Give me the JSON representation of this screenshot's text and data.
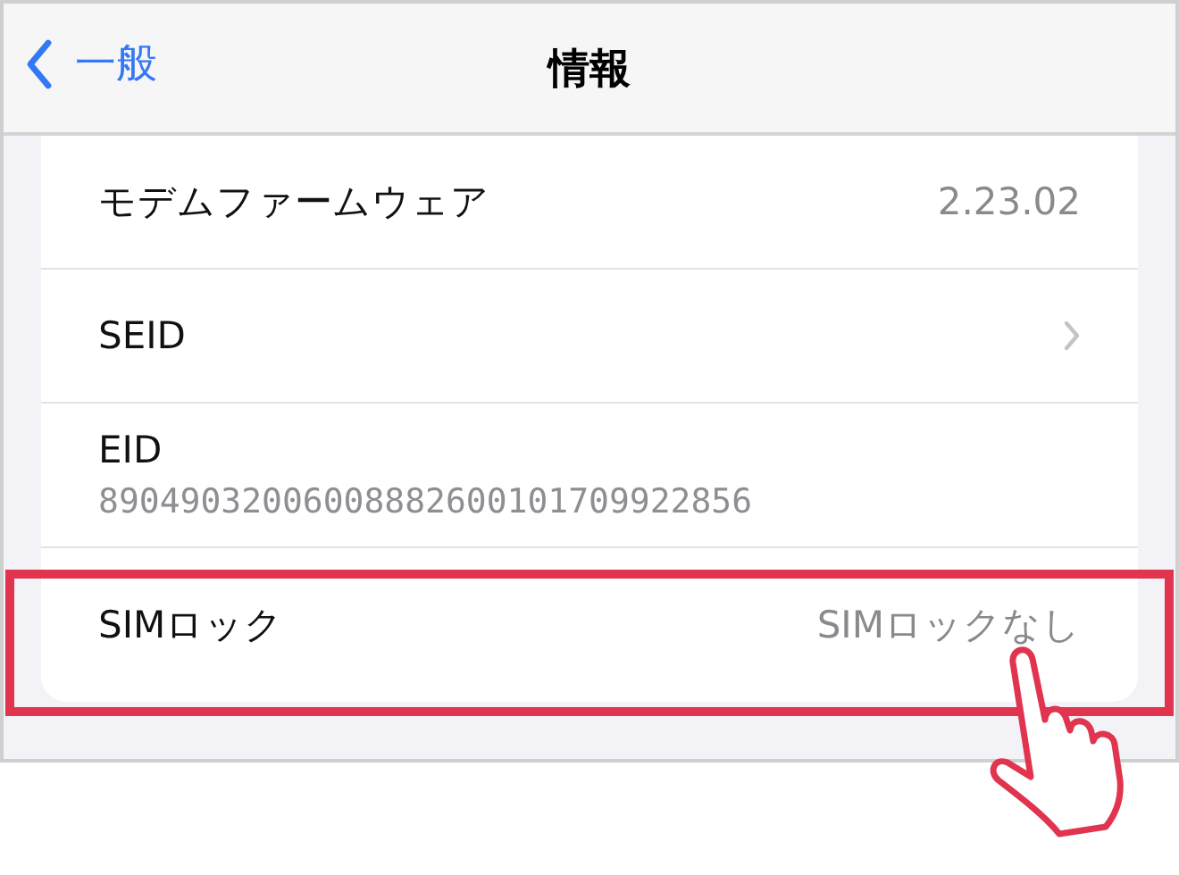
{
  "nav": {
    "back": "一般",
    "title": "情報"
  },
  "rows": [
    {
      "kind": "value",
      "label": "モデムファームウェア",
      "value": "2.23.02",
      "highlighted": false
    },
    {
      "kind": "disclosure",
      "label": "SEID",
      "highlighted": false
    },
    {
      "kind": "subtitle",
      "label": "EID",
      "value": "89049032006008882600101709922856",
      "highlighted": false
    },
    {
      "kind": "value",
      "label": "SIMロック",
      "value": "SIMロックなし",
      "highlighted": true
    }
  ]
}
